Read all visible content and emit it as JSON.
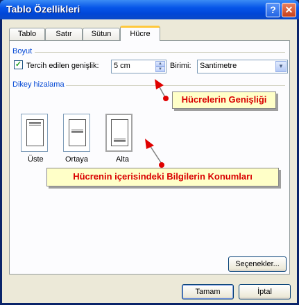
{
  "window": {
    "title": "Tablo Özellikleri",
    "help_label": "?",
    "close_label": "✕"
  },
  "tabs": [
    {
      "label": "Tablo"
    },
    {
      "label": "Satır"
    },
    {
      "label": "Sütun"
    },
    {
      "label": "Hücre",
      "active": true
    }
  ],
  "size_group": {
    "label": "Boyut",
    "checkbox_checked": true,
    "checkbox_mark": "✓",
    "preferred_width_label": "Tercih edilen genişlik:",
    "width_value": "5 cm",
    "unit_label": "Birimi:",
    "unit_value": "Santimetre"
  },
  "vertical_alignment": {
    "label": "Dikey hizalama",
    "options": [
      {
        "label": "Üste",
        "position": "top"
      },
      {
        "label": "Ortaya",
        "position": "center"
      },
      {
        "label": "Alta",
        "position": "bottom",
        "selected": true
      }
    ]
  },
  "buttons": {
    "options": "Seçenekler...",
    "ok": "Tamam",
    "cancel": "İptal"
  },
  "callouts": {
    "width": "Hücrelerin Genişliği",
    "position": "Hücrenin içerisindeki Bilgilerin Konumları"
  },
  "colors": {
    "accent_tab": "#ffc83c",
    "callout_text": "#d90000",
    "callout_bg": "#ffffc8",
    "group_label": "#0046d5"
  }
}
